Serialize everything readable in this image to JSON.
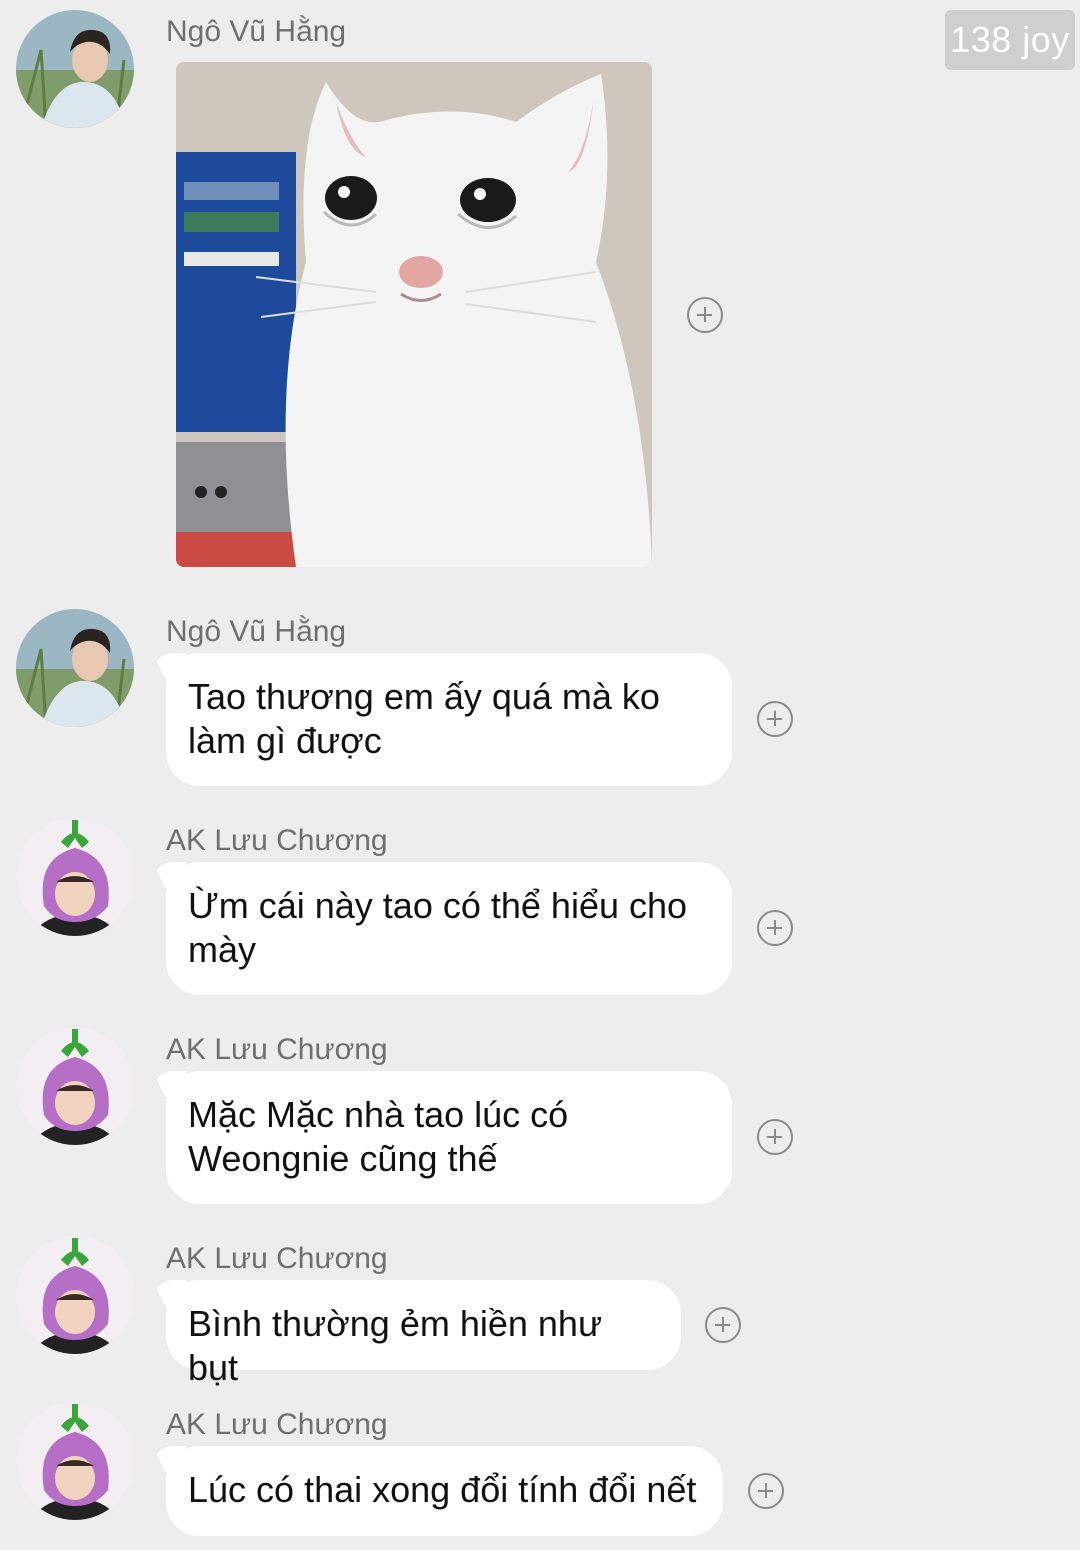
{
  "watermark": "138 joy",
  "messages": [
    {
      "sender": "Ngô Vũ Hằng",
      "type": "image",
      "image": "crying-white-cat-meme"
    },
    {
      "sender": "Ngô Vũ Hằng",
      "type": "text",
      "lines": [
        "Tao thương em ấy quá mà ko",
        "làm gì được"
      ]
    },
    {
      "sender": "AK Lưu Chương",
      "type": "text",
      "lines": [
        "Ừm cái này tao có thể hiểu cho",
        "mày"
      ]
    },
    {
      "sender": "AK Lưu Chương",
      "type": "text",
      "lines": [
        "Mặc Mặc nhà tao lúc có",
        "Weongnie cũng thế"
      ]
    },
    {
      "sender": "AK Lưu Chương",
      "type": "text",
      "lines": [
        "Bình thường ẻm hiền như bụt"
      ]
    },
    {
      "sender": "AK Lưu Chương",
      "type": "text",
      "lines": [
        "Lúc có thai xong đổi tính đổi nết"
      ]
    }
  ],
  "icons": {
    "react": "add-reaction-icon"
  },
  "colors": {
    "background": "#ededed",
    "bubble": "#ffffff",
    "sender": "#6f6f6f",
    "icon": "#8a8a8a"
  }
}
